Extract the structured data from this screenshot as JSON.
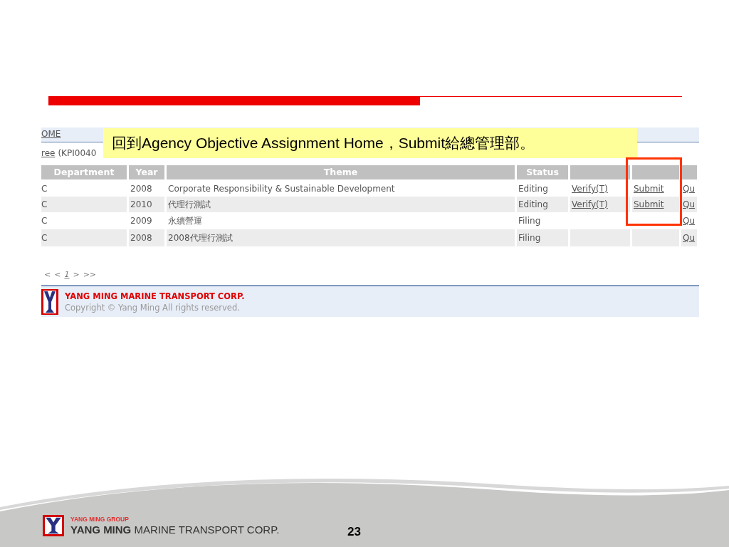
{
  "app": {
    "home_link": "OME",
    "breadcrumb_link": "ree",
    "breadcrumb_code": "(KPI0040",
    "table": {
      "columns": [
        "Department",
        "Year",
        "Theme",
        "Status"
      ],
      "rows": [
        {
          "department": "C",
          "year": "2008",
          "theme": "Corporate Responsibility & Sustainable Development",
          "status": "Editing",
          "verify": "Verify(T)",
          "submit": "Submit",
          "column_7": "Qu"
        },
        {
          "department": "C",
          "year": "2010",
          "theme": "代理行測試",
          "status": "Editing",
          "verify": "Verify(T)",
          "submit": "Submit",
          "column_7": "Qu"
        },
        {
          "department": "C",
          "year": "2009",
          "theme": "永續營運",
          "status": "Filing",
          "column_7": "Qu"
        },
        {
          "department": "C",
          "year": "2008",
          "theme": "2008代理行測試",
          "status": "Filing",
          "column_7": "Qu"
        }
      ]
    },
    "pager": [
      "<",
      "<",
      "1",
      ">",
      ">>"
    ],
    "footer": {
      "company": "YANG MING MARINE TRANSPORT CORP.",
      "copyright": "Copyright © Yang Ming All rights reserved."
    }
  },
  "callout": {
    "text": "回到Agency Objective Assignment Home，Submit給總管理部。"
  },
  "slide_footer": {
    "group": "YANG MING GROUP",
    "company_bold": "YANG MING",
    "company_rest": "MARINE TRANSPORT CORP.",
    "page_number": "23"
  }
}
